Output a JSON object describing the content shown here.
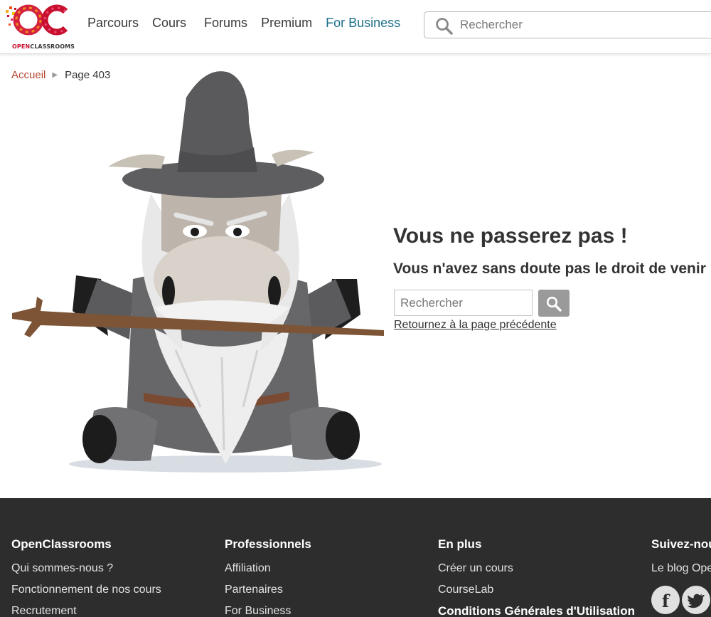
{
  "header": {
    "logo_text": {
      "open": "OPEN",
      "classrooms": "CLASSROOMS"
    },
    "nav": [
      "Parcours",
      "Cours",
      "Forums",
      "Premium",
      "For Business"
    ],
    "search": {
      "placeholder": "Rechercher"
    }
  },
  "breadcrumb": {
    "home": "Accueil",
    "current": "Page 403"
  },
  "error": {
    "title": "Vous ne passerez pas !",
    "subtitle": "Vous n'avez sans doute pas le droit de venir",
    "search_placeholder": "Rechercher",
    "back_link": "Retournez à la page précédente"
  },
  "footer": {
    "columns": [
      {
        "title": "OpenClassrooms",
        "links": [
          "Qui sommes-nous ?",
          "Fonctionnement de nos cours",
          "Recrutement"
        ]
      },
      {
        "title": "Professionnels",
        "links": [
          "Affiliation",
          "Partenaires",
          "For Business"
        ]
      },
      {
        "title": "En plus",
        "links": [
          "Créer un cours",
          "CourseLab"
        ],
        "bold_link": "Conditions Générales d'Utilisation"
      },
      {
        "title": "Suivez-nous",
        "links": [
          "Le blog OpenClassrooms"
        ]
      }
    ],
    "social": {
      "facebook": "f",
      "twitter": "twitter-icon"
    }
  },
  "colors": {
    "accent_red": "#c8102e",
    "business_blue": "#1f6f8b",
    "footer_bg": "#2d2d2d",
    "search_button": "#9a9a9a"
  }
}
